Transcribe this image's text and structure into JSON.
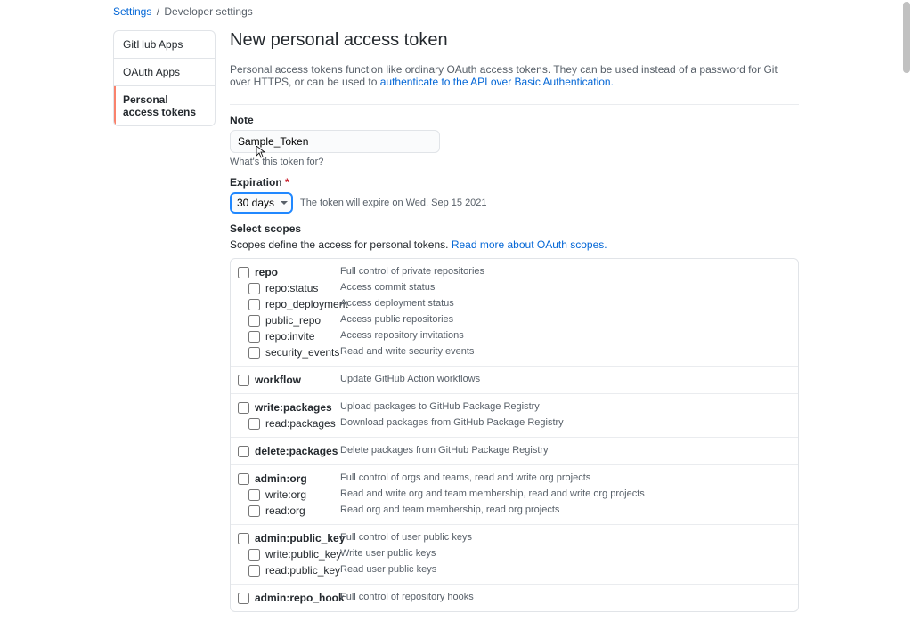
{
  "breadcrumb": {
    "settings": "Settings",
    "dev": "Developer settings"
  },
  "sidebar": {
    "items": [
      {
        "label": "GitHub Apps"
      },
      {
        "label": "OAuth Apps"
      },
      {
        "label": "Personal access tokens"
      }
    ]
  },
  "title": "New personal access token",
  "intro": {
    "pre": "Personal access tokens function like ordinary OAuth access tokens. They can be used instead of a password for Git over HTTPS, or can be used to ",
    "link": "authenticate to the API over Basic Authentication."
  },
  "note": {
    "label": "Note",
    "value": "Sample_Token",
    "hint": "What's this token for?"
  },
  "expiration": {
    "label": "Expiration",
    "value": "30 days",
    "hint": "The token will expire on Wed, Sep 15 2021"
  },
  "scopes": {
    "heading": "Select scopes",
    "desc_pre": "Scopes define the access for personal tokens. ",
    "desc_link": "Read more about OAuth scopes.",
    "groups": [
      {
        "name": "repo",
        "desc": "Full control of private repositories",
        "children": [
          {
            "name": "repo:status",
            "desc": "Access commit status"
          },
          {
            "name": "repo_deployment",
            "desc": "Access deployment status"
          },
          {
            "name": "public_repo",
            "desc": "Access public repositories"
          },
          {
            "name": "repo:invite",
            "desc": "Access repository invitations"
          },
          {
            "name": "security_events",
            "desc": "Read and write security events"
          }
        ]
      },
      {
        "name": "workflow",
        "desc": "Update GitHub Action workflows",
        "children": []
      },
      {
        "name": "write:packages",
        "desc": "Upload packages to GitHub Package Registry",
        "children": [
          {
            "name": "read:packages",
            "desc": "Download packages from GitHub Package Registry"
          }
        ]
      },
      {
        "name": "delete:packages",
        "desc": "Delete packages from GitHub Package Registry",
        "children": []
      },
      {
        "name": "admin:org",
        "desc": "Full control of orgs and teams, read and write org projects",
        "children": [
          {
            "name": "write:org",
            "desc": "Read and write org and team membership, read and write org projects"
          },
          {
            "name": "read:org",
            "desc": "Read org and team membership, read org projects"
          }
        ]
      },
      {
        "name": "admin:public_key",
        "desc": "Full control of user public keys",
        "children": [
          {
            "name": "write:public_key",
            "desc": "Write user public keys"
          },
          {
            "name": "read:public_key",
            "desc": "Read user public keys"
          }
        ]
      },
      {
        "name": "admin:repo_hook",
        "desc": "Full control of repository hooks",
        "children": []
      }
    ]
  }
}
